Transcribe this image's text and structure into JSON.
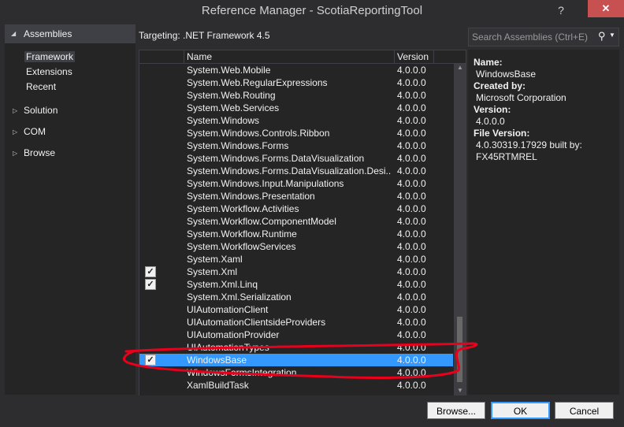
{
  "window": {
    "title": "Reference Manager - ScotiaReportingTool",
    "help": "?",
    "close": "✕"
  },
  "sidebar": {
    "header": "Assemblies",
    "subitems": [
      "Framework",
      "Extensions",
      "Recent"
    ],
    "groups": [
      "Solution",
      "COM",
      "Browse"
    ]
  },
  "targeting": "Targeting: .NET Framework 4.5",
  "search": {
    "placeholder": "Search Assemblies (Ctrl+E)"
  },
  "list": {
    "columns": {
      "name": "Name",
      "version": "Version"
    },
    "rows": [
      {
        "name": "System.Web.Mobile",
        "version": "4.0.0.0",
        "checked": false
      },
      {
        "name": "System.Web.RegularExpressions",
        "version": "4.0.0.0",
        "checked": false
      },
      {
        "name": "System.Web.Routing",
        "version": "4.0.0.0",
        "checked": false
      },
      {
        "name": "System.Web.Services",
        "version": "4.0.0.0",
        "checked": false
      },
      {
        "name": "System.Windows",
        "version": "4.0.0.0",
        "checked": false
      },
      {
        "name": "System.Windows.Controls.Ribbon",
        "version": "4.0.0.0",
        "checked": false
      },
      {
        "name": "System.Windows.Forms",
        "version": "4.0.0.0",
        "checked": false
      },
      {
        "name": "System.Windows.Forms.DataVisualization",
        "version": "4.0.0.0",
        "checked": false
      },
      {
        "name": "System.Windows.Forms.DataVisualization.Desi...",
        "version": "4.0.0.0",
        "checked": false
      },
      {
        "name": "System.Windows.Input.Manipulations",
        "version": "4.0.0.0",
        "checked": false
      },
      {
        "name": "System.Windows.Presentation",
        "version": "4.0.0.0",
        "checked": false
      },
      {
        "name": "System.Workflow.Activities",
        "version": "4.0.0.0",
        "checked": false
      },
      {
        "name": "System.Workflow.ComponentModel",
        "version": "4.0.0.0",
        "checked": false
      },
      {
        "name": "System.Workflow.Runtime",
        "version": "4.0.0.0",
        "checked": false
      },
      {
        "name": "System.WorkflowServices",
        "version": "4.0.0.0",
        "checked": false
      },
      {
        "name": "System.Xaml",
        "version": "4.0.0.0",
        "checked": false
      },
      {
        "name": "System.Xml",
        "version": "4.0.0.0",
        "checked": true
      },
      {
        "name": "System.Xml.Linq",
        "version": "4.0.0.0",
        "checked": true
      },
      {
        "name": "System.Xml.Serialization",
        "version": "4.0.0.0",
        "checked": false
      },
      {
        "name": "UIAutomationClient",
        "version": "4.0.0.0",
        "checked": false
      },
      {
        "name": "UIAutomationClientsideProviders",
        "version": "4.0.0.0",
        "checked": false
      },
      {
        "name": "UIAutomationProvider",
        "version": "4.0.0.0",
        "checked": false
      },
      {
        "name": "UIAutomationTypes",
        "version": "4.0.0.0",
        "checked": false
      },
      {
        "name": "WindowsBase",
        "version": "4.0.0.0",
        "checked": true,
        "selected": true
      },
      {
        "name": "WindowsFormsIntegration",
        "version": "4.0.0.0",
        "checked": false
      },
      {
        "name": "XamlBuildTask",
        "version": "4.0.0.0",
        "checked": false
      }
    ]
  },
  "details": {
    "name_label": "Name:",
    "name_value": "WindowsBase",
    "created_label": "Created by:",
    "created_value": "Microsoft Corporation",
    "version_label": "Version:",
    "version_value": "4.0.0.0",
    "file_version_label": "File Version:",
    "file_version_line1": "4.0.30319.17929 built by:",
    "file_version_line2": "FX45RTMREL"
  },
  "buttons": {
    "browse": "Browse...",
    "ok": "OK",
    "cancel": "Cancel"
  },
  "colors": {
    "selection": "#3399ff",
    "annotation": "#e8001c",
    "close": "#c75050"
  }
}
